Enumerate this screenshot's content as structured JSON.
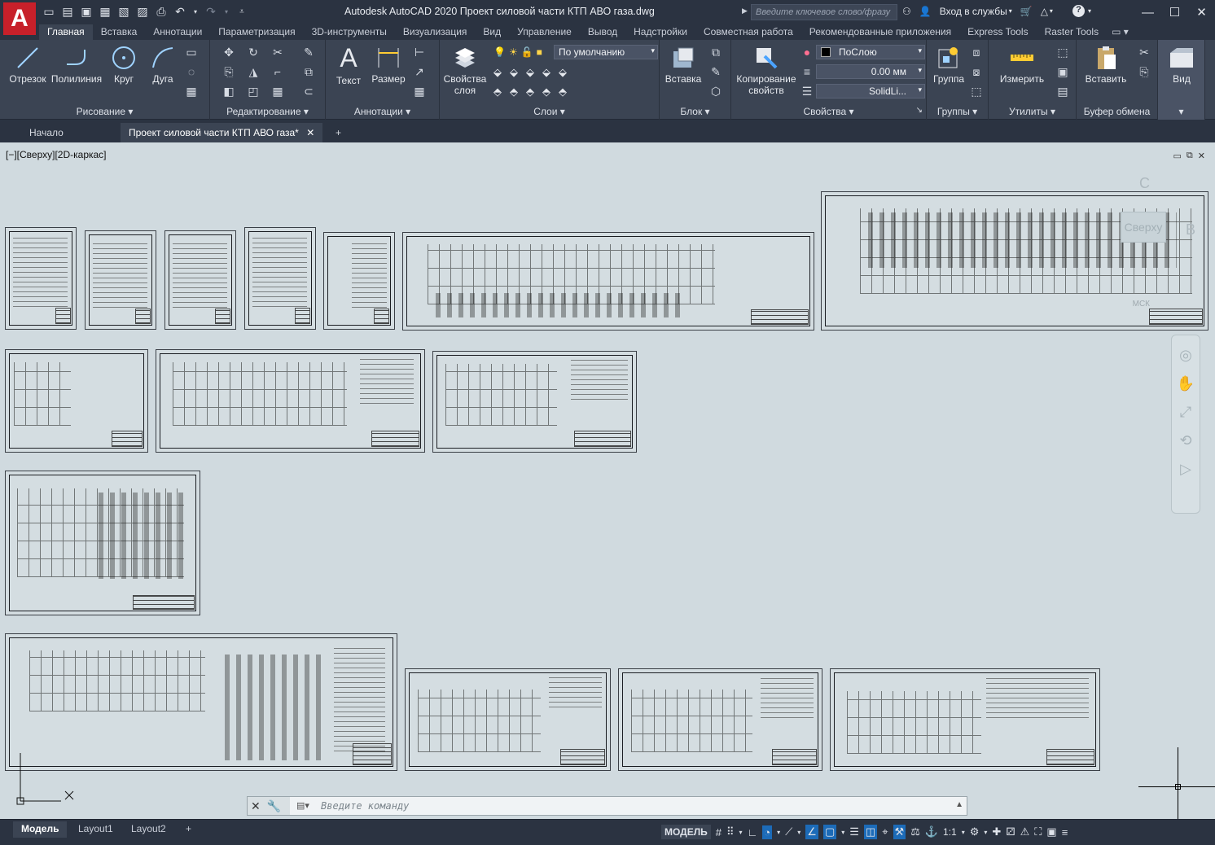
{
  "app": {
    "title": "Autodesk AutoCAD 2020   Проект силовой части КТП АВО газа.dwg",
    "logo_letter": "A",
    "search_placeholder": "Введите ключевое слово/фразу",
    "signin": "Вход в службы",
    "help": "?"
  },
  "ribbon_tabs": [
    "Главная",
    "Вставка",
    "Аннотации",
    "Параметризация",
    "3D-инструменты",
    "Визуализация",
    "Вид",
    "Управление",
    "Вывод",
    "Надстройки",
    "Совместная работа",
    "Рекомендованные приложения",
    "Express Tools",
    "Raster Tools"
  ],
  "ribbon": {
    "draw": {
      "title": "Рисование",
      "line": "Отрезок",
      "polyline": "Полилиния",
      "circle": "Круг",
      "arc": "Дуга"
    },
    "modify": {
      "title": "Редактирование"
    },
    "annotation": {
      "title": "Аннотации",
      "text": "Текст",
      "dimension": "Размер"
    },
    "layers": {
      "title": "Слои",
      "properties": "Свойства слоя",
      "current_layer": "По умолчанию"
    },
    "block": {
      "title": "Блок",
      "insert": "Вставка"
    },
    "properties": {
      "title": "Свойства",
      "match": "Копирование свойств",
      "color": "ПоСлою",
      "lineweight": "0.00 мм",
      "linetype": "SolidLi..."
    },
    "groups": {
      "title": "Группы",
      "group": "Группа"
    },
    "utilities": {
      "title": "Утилиты",
      "measure": "Измерить"
    },
    "clipboard": {
      "title": "Буфер обмена",
      "paste": "Вставить"
    },
    "view": {
      "title": "Вид"
    }
  },
  "doc_tabs": {
    "start": "Начало",
    "active": "Проект силовой части КТП АВО газа*",
    "close": "✕",
    "new": "+"
  },
  "viewport": {
    "label": "[−][Сверху][2D-каркас]",
    "cube_top": "Сверху",
    "cube_n": "С",
    "cube_e": "В",
    "cube_wcs": "МСК"
  },
  "command": {
    "placeholder": "Введите команду"
  },
  "layouts": [
    "Модель",
    "Layout1",
    "Layout2",
    "+"
  ],
  "status": {
    "model": "МОДЕЛЬ",
    "scale": "1:1"
  }
}
